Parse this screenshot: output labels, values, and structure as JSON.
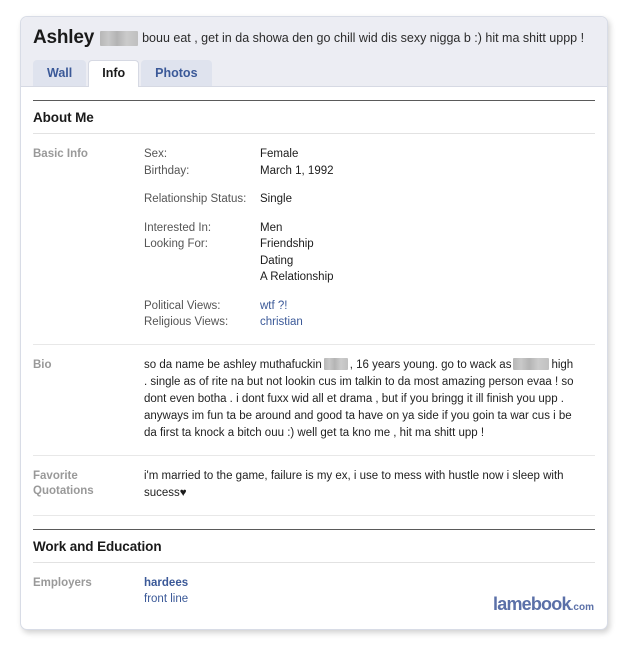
{
  "page": {
    "watermark_brand": "lamebook",
    "watermark_tld": ".com"
  },
  "header": {
    "profile_name": "Ashley",
    "status_text": "bouu eat , get in da showa den go chill wid dis sexy nigga b :) hit ma shitt uppp !",
    "tabs": [
      {
        "label": "Wall",
        "active": false
      },
      {
        "label": "Info",
        "active": true
      },
      {
        "label": "Photos",
        "active": false
      }
    ]
  },
  "sections": [
    {
      "title": "About Me",
      "rows": [
        {
          "label": "Basic Info",
          "groups": [
            [
              {
                "key": "Sex:",
                "value": "Female"
              },
              {
                "key": "Birthday:",
                "value": "March 1, 1992"
              }
            ],
            [
              {
                "key": "Relationship Status:",
                "value": "Single"
              }
            ],
            [
              {
                "key": "Interested In:",
                "value": "Men"
              },
              {
                "key": "Looking For:",
                "value": "Friendship"
              }
            ],
            [
              {
                "key": "Political Views:",
                "value": "wtf ?!"
              },
              {
                "key": "Religious Views:",
                "value": "christian"
              }
            ]
          ],
          "looking_for_extra": [
            "Dating",
            "A Relationship"
          ]
        },
        {
          "label": "Bio",
          "text_part_1": "so da name be ashley muthafuckin",
          "text_part_2": ", 16 years young. go to wack as",
          "text_part_3": "high . single as of rite na but not lookin cus im talkin to da most amazing person evaa ! so dont even botha . i dont fuxx wid all et drama , but if you bringg it ill finish you upp . anyways im fun ta be around and good ta have on ya side if you goin ta war cus i be da first ta knock a bitch ouu :) well get ta kno me , hit ma shitt upp !"
        },
        {
          "label": "Favorite Quotations",
          "label_line_1": "Favorite",
          "label_line_2": "Quotations",
          "text": "i'm married to the game, failure is my ex, i use to mess with hustle now i sleep with sucess",
          "heart": "♥"
        }
      ]
    },
    {
      "title": "Work and Education",
      "employers": {
        "label": "Employers",
        "name": "hardees",
        "position": "front line"
      }
    }
  ]
}
